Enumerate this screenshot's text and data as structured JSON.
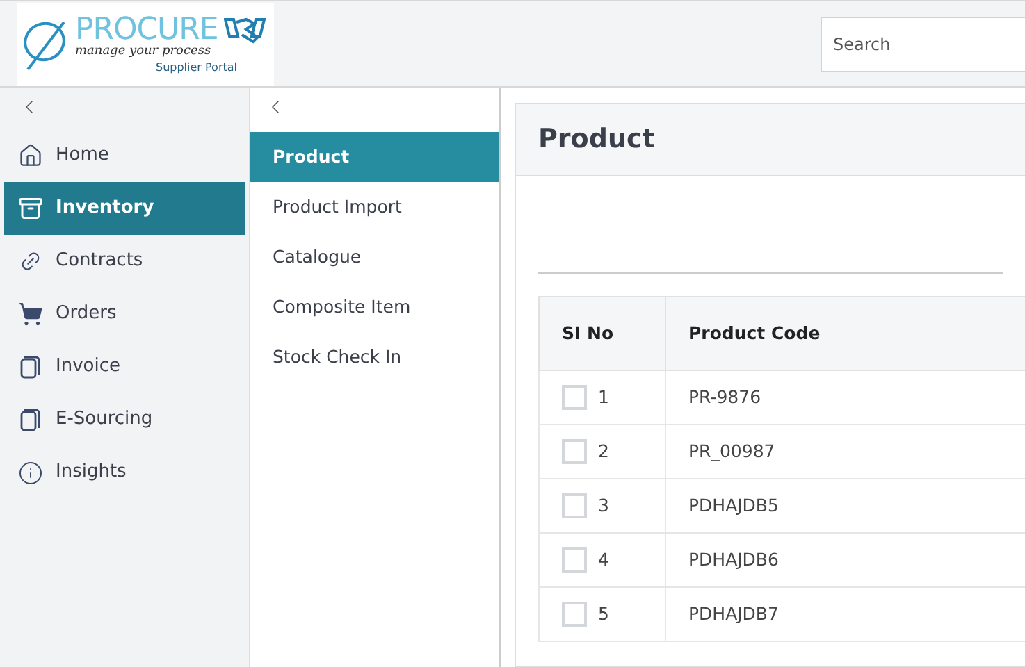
{
  "logo": {
    "name": "PROCURE",
    "tagline": "manage your process",
    "subtitle": "Supplier Portal"
  },
  "search": {
    "placeholder": "Search"
  },
  "sidebar": {
    "items": [
      {
        "label": "Home",
        "kind": "home",
        "selected": false
      },
      {
        "label": "Inventory",
        "kind": "archive",
        "selected": true
      },
      {
        "label": "Contracts",
        "kind": "link",
        "selected": false
      },
      {
        "label": "Orders",
        "kind": "cart",
        "selected": false
      },
      {
        "label": "Invoice",
        "kind": "doc",
        "selected": false
      },
      {
        "label": "E-Sourcing",
        "kind": "doc",
        "selected": false
      },
      {
        "label": "Insights",
        "kind": "info",
        "selected": false
      }
    ]
  },
  "subnav": {
    "items": [
      {
        "label": "Product",
        "selected": true
      },
      {
        "label": "Product Import",
        "selected": false
      },
      {
        "label": "Catalogue",
        "selected": false
      },
      {
        "label": "Composite Item",
        "selected": false
      },
      {
        "label": "Stock Check In",
        "selected": false
      }
    ]
  },
  "page": {
    "title": "Product"
  },
  "table": {
    "columns": [
      "SI No",
      "Product Code"
    ],
    "rows": [
      {
        "si": "1",
        "code": "PR-9876",
        "checked": false
      },
      {
        "si": "2",
        "code": "PR_00987",
        "checked": false
      },
      {
        "si": "3",
        "code": "PDHAJDB5",
        "checked": false
      },
      {
        "si": "4",
        "code": "PDHAJDB6",
        "checked": false
      },
      {
        "si": "5",
        "code": "PDHAJDB7",
        "checked": false
      }
    ]
  }
}
